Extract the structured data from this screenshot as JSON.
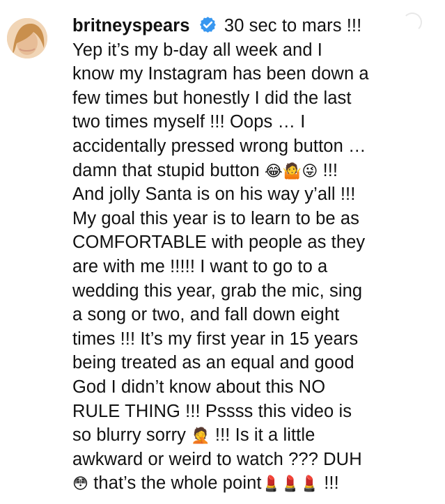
{
  "post": {
    "username": "britneyspears",
    "lines": [
      "30 sec to mars !!!",
      "Yep it’s my b-day all week and I",
      "know my Instagram has been down a",
      "few times but honestly I did the last",
      "two times myself !!! Oops … I",
      "accidentally pressed wrong button …",
      "damn that stupid button",
      "!!!",
      "And jolly Santa is on his way y’all !!!",
      "My goal this year is to learn to be as",
      "COMFORTABLE with people as they",
      "are with me !!!!! I want to go to a",
      "wedding this year, grab the mic, sing",
      "a song or two, and fall down eight",
      "times !!! It’s my first year in 15 years",
      "being treated as an equal and good",
      "God I didn’t know about this NO",
      "RULE THING !!! Pssss this video is",
      "so blurry sorry",
      "!!! Is it a little",
      "awkward or weird to watch ??? DUH",
      "that’s the whole point",
      "!!!"
    ]
  },
  "icons": {
    "verified": "verified-badge-icon",
    "avatar": "profile-avatar",
    "emoji_laugh": "😂",
    "emoji_shrug": "🤷",
    "emoji_wink": "😜",
    "emoji_facepalm": "🤦",
    "emoji_flushed": "😳",
    "emoji_lipstick": "💄"
  },
  "colors": {
    "text": "#111111",
    "verified_blue": "#3897f0"
  }
}
